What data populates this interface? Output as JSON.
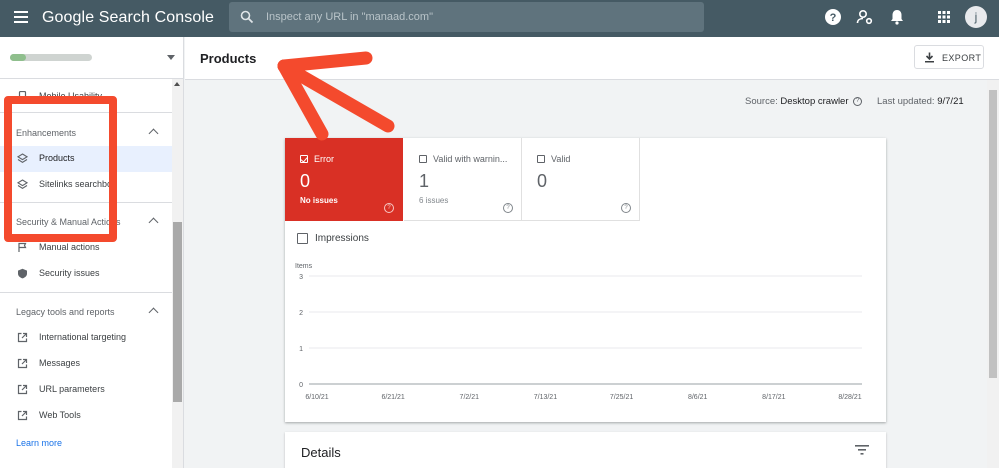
{
  "app": {
    "title": "Google Search Console",
    "search_placeholder": "Inspect any URL in \"manaad.com\"",
    "user_initial": "j"
  },
  "topbar_icons": [
    "menu-icon",
    "help-icon",
    "account-settings-icon",
    "notifications-bell-icon",
    "apps-grid-icon"
  ],
  "sidebar": {
    "items_top": [
      {
        "label": "Mobile Usability",
        "icon": "phone-icon"
      }
    ],
    "sections": [
      {
        "title": "Enhancements",
        "items": [
          {
            "label": "Products",
            "icon": "layers-icon",
            "active": true
          },
          {
            "label": "Sitelinks searchbox",
            "icon": "layers-icon"
          }
        ]
      },
      {
        "title": "Security & Manual Actions",
        "items": [
          {
            "label": "Manual actions",
            "icon": "flag-icon"
          },
          {
            "label": "Security issues",
            "icon": "shield-icon"
          }
        ]
      },
      {
        "title": "Legacy tools and reports",
        "items": [
          {
            "label": "International targeting",
            "icon": "external-link-icon"
          },
          {
            "label": "Messages",
            "icon": "external-link-icon"
          },
          {
            "label": "URL parameters",
            "icon": "external-link-icon"
          },
          {
            "label": "Web Tools",
            "icon": "external-link-icon"
          }
        ]
      }
    ],
    "learn_more": "Learn more"
  },
  "page": {
    "title": "Products",
    "export_label": "EXPORT",
    "source_label": "Source:",
    "source_value": "Desktop crawler",
    "updated_label": "Last updated:",
    "updated_value": "9/7/21"
  },
  "tiles": [
    {
      "label": "Error",
      "count": "0",
      "sub": "No issues",
      "checked": true
    },
    {
      "label": "Valid with warnin...",
      "count": "1",
      "sub": "6 issues",
      "checked": false
    },
    {
      "label": "Valid",
      "count": "0",
      "sub": "",
      "checked": false
    }
  ],
  "impressions_label": "Impressions",
  "chart_data": {
    "type": "line",
    "ylabel": "Items",
    "ylim": [
      0,
      3
    ],
    "y_ticks": [
      "3",
      "2",
      "1",
      "0"
    ],
    "categories": [
      "6/10/21",
      "6/21/21",
      "7/2/21",
      "7/13/21",
      "7/25/21",
      "8/6/21",
      "8/17/21",
      "8/28/21"
    ],
    "series": [],
    "grid": true
  },
  "details_title": "Details",
  "colors": {
    "topbar": "#455a64",
    "error": "#d93025",
    "annotation": "#f44a2d",
    "link": "#1a73e8"
  }
}
